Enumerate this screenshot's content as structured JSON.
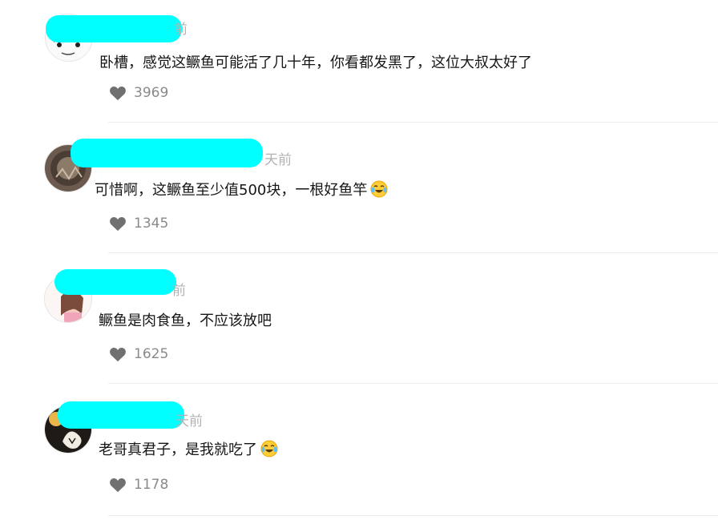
{
  "comments": [
    {
      "time_suffix": "前",
      "text": "卧槽，感觉这鳜鱼可能活了几十年，你看都发黑了，这位大叔太好了",
      "likes": "3969",
      "avatar_icon": "avatar-sketch-icon"
    },
    {
      "time_suffix": "天前",
      "text": "可惜啊，这鳜鱼至少值500块，一根好鱼竿",
      "likes": "1345",
      "emoji_icon": "laughing-crying-emoji-icon",
      "avatar_icon": "avatar-dark-circle-icon"
    },
    {
      "time_suffix": "前",
      "text": "鳜鱼是肉食鱼，不应该放吧",
      "likes": "1625",
      "avatar_icon": "avatar-girl-icon"
    },
    {
      "time_suffix": "天前",
      "text": "老哥真君子，是我就吃了",
      "likes": "1178",
      "emoji_icon": "laughing-crying-emoji-icon",
      "avatar_icon": "avatar-art-icon"
    }
  ],
  "colors": {
    "redaction": "#00ffff",
    "like_icon": "#707070",
    "meta_text": "#b3b3b3"
  }
}
